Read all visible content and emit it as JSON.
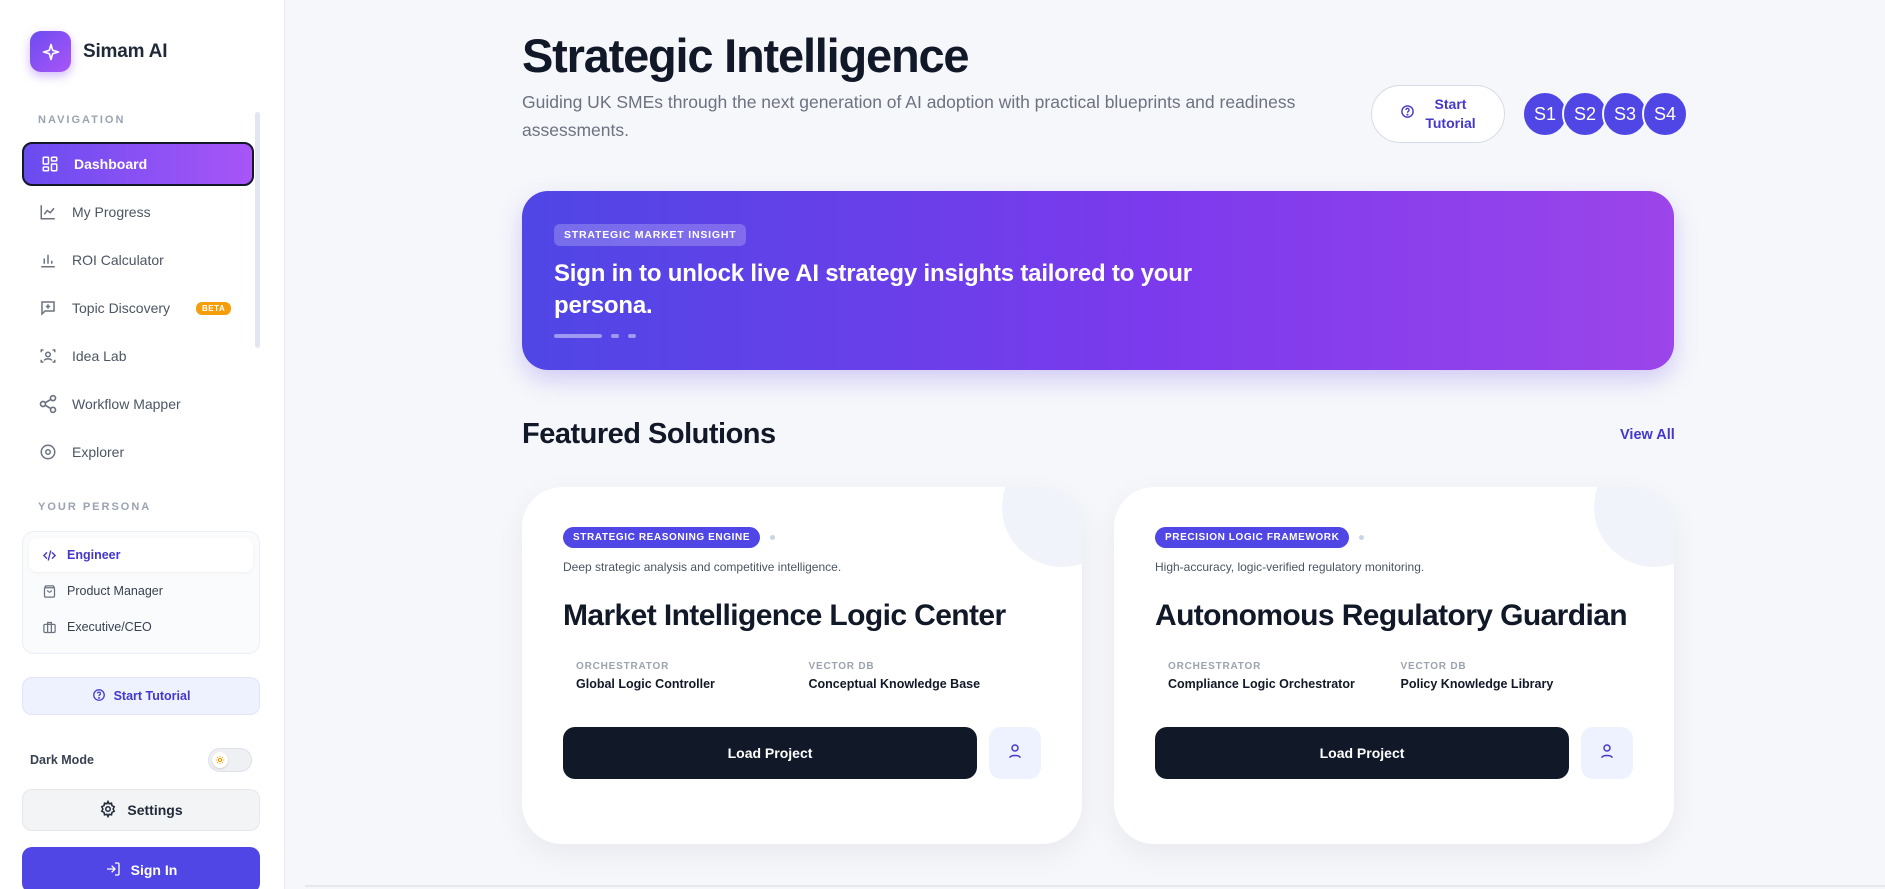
{
  "app": {
    "name": "Simam AI"
  },
  "sidebar": {
    "navigation_label": "NAVIGATION",
    "items": [
      {
        "label": "Dashboard",
        "icon": "dashboard-icon",
        "active": true
      },
      {
        "label": "My Progress",
        "icon": "chart-line-icon"
      },
      {
        "label": "ROI Calculator",
        "icon": "bar-chart-icon"
      },
      {
        "label": "Topic Discovery",
        "icon": "message-plus-icon",
        "badge": "BETA"
      },
      {
        "label": "Idea Lab",
        "icon": "scan-user-icon"
      },
      {
        "label": "Workflow Mapper",
        "icon": "share-icon"
      },
      {
        "label": "Explorer",
        "icon": "compass-icon"
      }
    ],
    "persona_label": "YOUR PERSONA",
    "personas": [
      {
        "label": "Engineer",
        "icon": "code-icon",
        "active": true
      },
      {
        "label": "Product Manager",
        "icon": "bag-icon"
      },
      {
        "label": "Executive/CEO",
        "icon": "briefcase-icon"
      }
    ],
    "tutorial_label": "Start Tutorial",
    "dark_mode_label": "Dark Mode",
    "dark_mode_on": false,
    "settings_label": "Settings",
    "sign_in_label": "Sign In"
  },
  "header": {
    "title": "Strategic Intelligence",
    "subtitle": "Guiding UK SMEs through the next generation of AI adoption with practical blueprints and readiness assessments.",
    "tutorial_line1": "Start",
    "tutorial_line2": "Tutorial",
    "steps": [
      "S1",
      "S2",
      "S3",
      "S4"
    ]
  },
  "hero": {
    "badge": "STRATEGIC MARKET INSIGHT",
    "text": "Sign in to unlock live AI strategy insights tailored to your persona."
  },
  "featured": {
    "title": "Featured Solutions",
    "view_all": "View All",
    "cards": [
      {
        "badge": "STRATEGIC REASONING ENGINE",
        "description": "Deep strategic analysis and competitive intelligence.",
        "title": "Market Intelligence Logic Center",
        "orchestrator_label": "ORCHESTRATOR",
        "orchestrator": "Global Logic Controller",
        "vector_label": "VECTOR DB",
        "vector": "Conceptual Knowledge Base",
        "action": "Load Project"
      },
      {
        "badge": "PRECISION LOGIC FRAMEWORK",
        "description": "High-accuracy, logic-verified regulatory monitoring.",
        "title": "Autonomous Regulatory Guardian",
        "orchestrator_label": "ORCHESTRATOR",
        "orchestrator": "Compliance Logic Orchestrator",
        "vector_label": "VECTOR DB",
        "vector": "Policy Knowledge Library",
        "action": "Load Project"
      }
    ]
  },
  "colors": {
    "accent": "#4f46e5",
    "gradient_start": "#6a4cf0",
    "gradient_end": "#a855f7",
    "dark": "#111827",
    "beta": "#f59e0b"
  }
}
